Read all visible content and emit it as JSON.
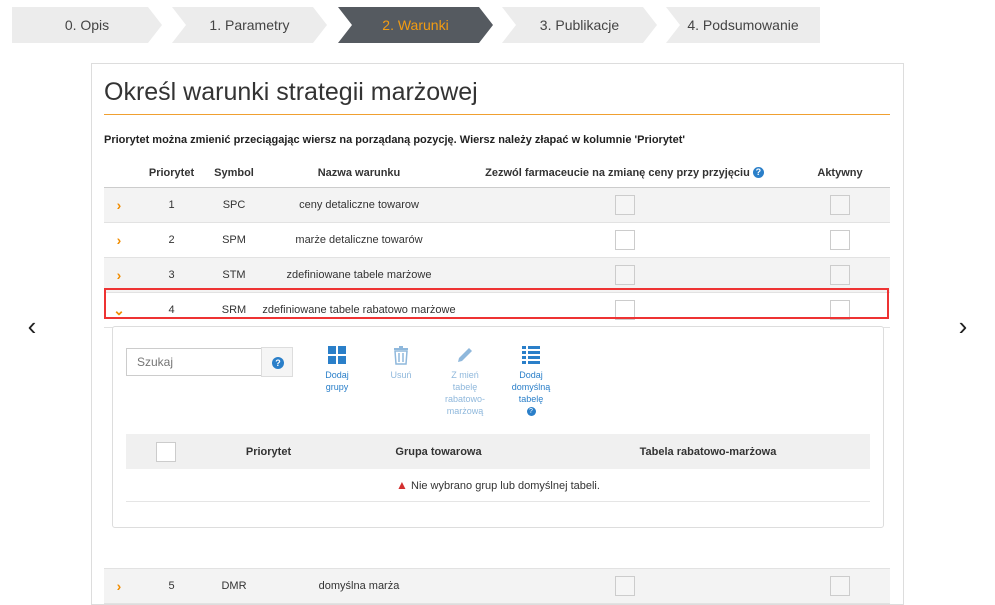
{
  "wizard": {
    "steps": [
      "0. Opis",
      "1. Parametry",
      "2. Warunki",
      "3. Publikacje",
      "4. Podsumowanie"
    ],
    "active_index": 2
  },
  "nav": {
    "prev": "‹",
    "next": "›"
  },
  "page": {
    "title": "Określ warunki strategii marżowej",
    "hint": "Priorytet można zmienić przeciągając wiersz na porządaną pozycję. Wiersz należy złapać w kolumnie 'Priorytet'"
  },
  "table": {
    "headers": {
      "priority": "Priorytet",
      "symbol": "Symbol",
      "name": "Nazwa warunku",
      "allow": "Zezwól farmaceucie na zmianę ceny przy przyjęciu",
      "active": "Aktywny"
    },
    "rows": [
      {
        "priority": "1",
        "symbol": "SPC",
        "name": "ceny detaliczne towarow"
      },
      {
        "priority": "2",
        "symbol": "SPM",
        "name": "marże detaliczne towarów"
      },
      {
        "priority": "3",
        "symbol": "STM",
        "name": "zdefiniowane tabele marżowe"
      },
      {
        "priority": "4",
        "symbol": "SRM",
        "name": "zdefiniowane tabele rabatowo marżowe"
      },
      {
        "priority": "5",
        "symbol": "DMR",
        "name": "domyślna marża"
      }
    ]
  },
  "subpanel": {
    "search_placeholder": "Szukaj",
    "tools": {
      "add_groups": "Dodaj grupy",
      "remove": "Usuń",
      "change_table": "Z mień tabelę rabatowo-marżową",
      "add_default": "Dodaj domyślną tabelę"
    },
    "headers": {
      "priority": "Priorytet",
      "group": "Grupa towarowa",
      "table": "Tabela rabatowo-marżowa"
    },
    "empty_message": "Nie wybrano grup lub domyślnej tabeli."
  },
  "colors": {
    "accent": "#f39c12",
    "link": "#2a7fc9",
    "highlight": "#e33333"
  }
}
